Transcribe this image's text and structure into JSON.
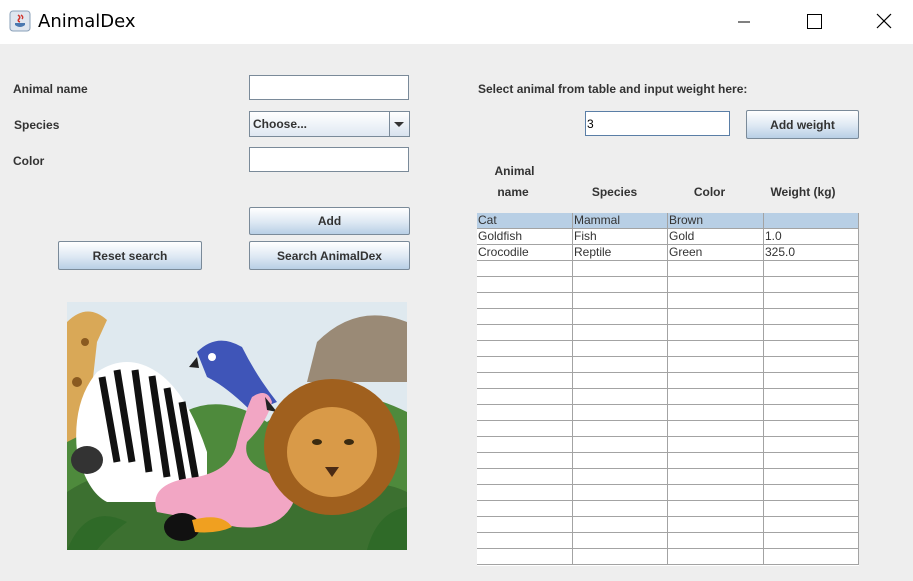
{
  "window": {
    "title": "AnimalDex"
  },
  "form": {
    "animal_name_label": "Animal name",
    "species_label": "Species",
    "color_label": "Color",
    "species_selected": "Choose...",
    "add_button": "Add",
    "reset_search_button": "Reset search",
    "search_button": "Search AnimalDex"
  },
  "weight": {
    "instruction": "Select animal from table and input weight here:",
    "input_value": "3",
    "add_weight_button": "Add weight"
  },
  "table": {
    "headers": {
      "name_line1": "Animal",
      "name_line2": "name",
      "species": "Species",
      "color": "Color",
      "weight": "Weight (kg)"
    },
    "rows": [
      {
        "name": "Cat",
        "species": "Mammal",
        "color": "Brown",
        "weight": ""
      },
      {
        "name": "Goldfish",
        "species": "Fish",
        "color": "Gold",
        "weight": "1.0"
      },
      {
        "name": "Crocodile",
        "species": "Reptile",
        "color": "Green",
        "weight": "325.0"
      }
    ],
    "selected_row": 0
  },
  "image": {
    "subject": "jungle-animals-illustration"
  }
}
